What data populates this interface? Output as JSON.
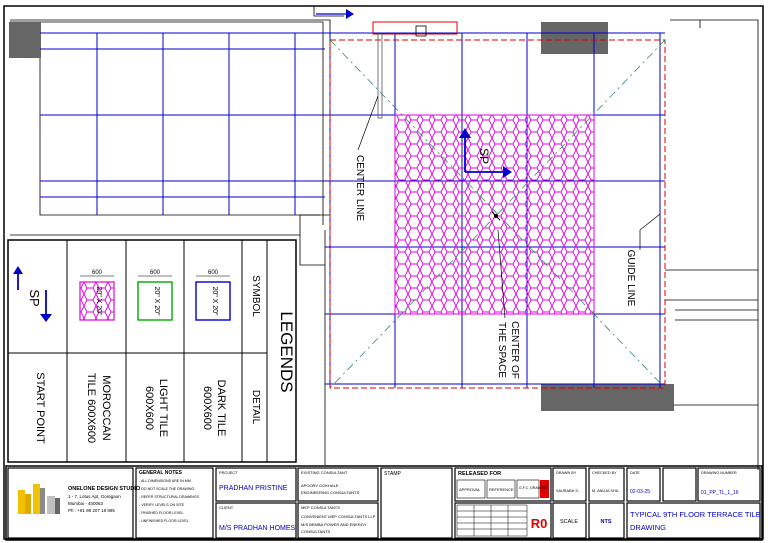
{
  "drawing": {
    "plan_labels": {
      "center_line": "CENTER LINE",
      "guide_line": "GUIDE LINE",
      "center_space_1": "CENTER OF",
      "center_space_2": "THE SPACE",
      "sp_marker": "SP"
    },
    "legend": {
      "title": "LEGENDS",
      "col_symbol": "SYMBOL",
      "col_detail": "DETAIL",
      "rows": [
        {
          "symbol_text": "SP",
          "detail": "START POINT"
        },
        {
          "symbol_text": "20\" X 20\"",
          "dim": "600",
          "detail_1": "MOROCCAN",
          "detail_2": "TILE 600X600"
        },
        {
          "symbol_text": "20\" X 20\"",
          "dim": "600",
          "detail_1": "LIGHT TILE",
          "detail_2": "600X600"
        },
        {
          "symbol_text": "20\" X 20\"",
          "dim": "600",
          "detail_1": "DARK TILE",
          "detail_2": "600X600"
        }
      ]
    },
    "colors": {
      "grid": "#0000cc",
      "moroccan": "#e000e0",
      "red_dash": "#e00000",
      "light_tile": "#00aa00",
      "dark_tile": "#0000cc",
      "dark_block": "#666666"
    }
  },
  "title_block": {
    "studio": {
      "name": "ONELONE DESIGN STUDIO",
      "line1": "1 - 7, Lotus Apt, Goregaon",
      "line2": "Mumbai - 400063",
      "line3": "Ph : +91 98 207 18 995"
    },
    "general_notes": {
      "title": "GENERAL NOTES",
      "lines": [
        "- ALL DIMENSIONS ARE IN MM",
        "- DO NOT SCALE THE DRAWING",
        "- REFER STRUCTURAL DRAWINGS",
        "- VERIFY LEVELS ON SITE",
        "- FINISHED FLOOR LEVEL",
        "- UNFINISHED FLOOR LEVEL"
      ]
    },
    "project": {
      "label": "PROJECT",
      "value": "PRADHAN PRISTINE"
    },
    "client": {
      "label": "CLIENT",
      "value": "M/S PRADHAN HOMES"
    },
    "existing_consultant": {
      "label": "EXISTING CONSULTANT",
      "line1": "APOORV GOKHALE",
      "line2": "ENGINEERING CONSULTANTS"
    },
    "mep_consultant": {
      "label": "MEP CONSULTANTS",
      "line1": "CONVENIENT MEP CONSULTANTS LLP",
      "line2": "M/S BEMBA POWER AND ENERGY",
      "line3": "CONSULTANTS"
    },
    "stamp": {
      "label": "STAMP"
    },
    "released_for": {
      "label": "RELEASED FOR",
      "opt1": "APPROVAL",
      "opt2": "REFERENCE",
      "opt3": "G.F.C. DRAWING"
    },
    "revision": "R0",
    "scale": {
      "label": "SCALE",
      "value": "NTS"
    },
    "drawn_by": {
      "label": "DRAWN BY",
      "value": "SAURABH S."
    },
    "checked_by": {
      "label": "CHECKED BY",
      "value": "M. ANUJA SHIL"
    },
    "date": {
      "label": "DATE",
      "value": "02-03-25"
    },
    "drawing_number": {
      "label": "DRAWING NUMBER",
      "value": "01_PP_TL_1_16"
    },
    "drawing_title_1": "TYPICAL 9TH FLOOR TERRACE TILE",
    "drawing_title_2": "DRAWING"
  }
}
